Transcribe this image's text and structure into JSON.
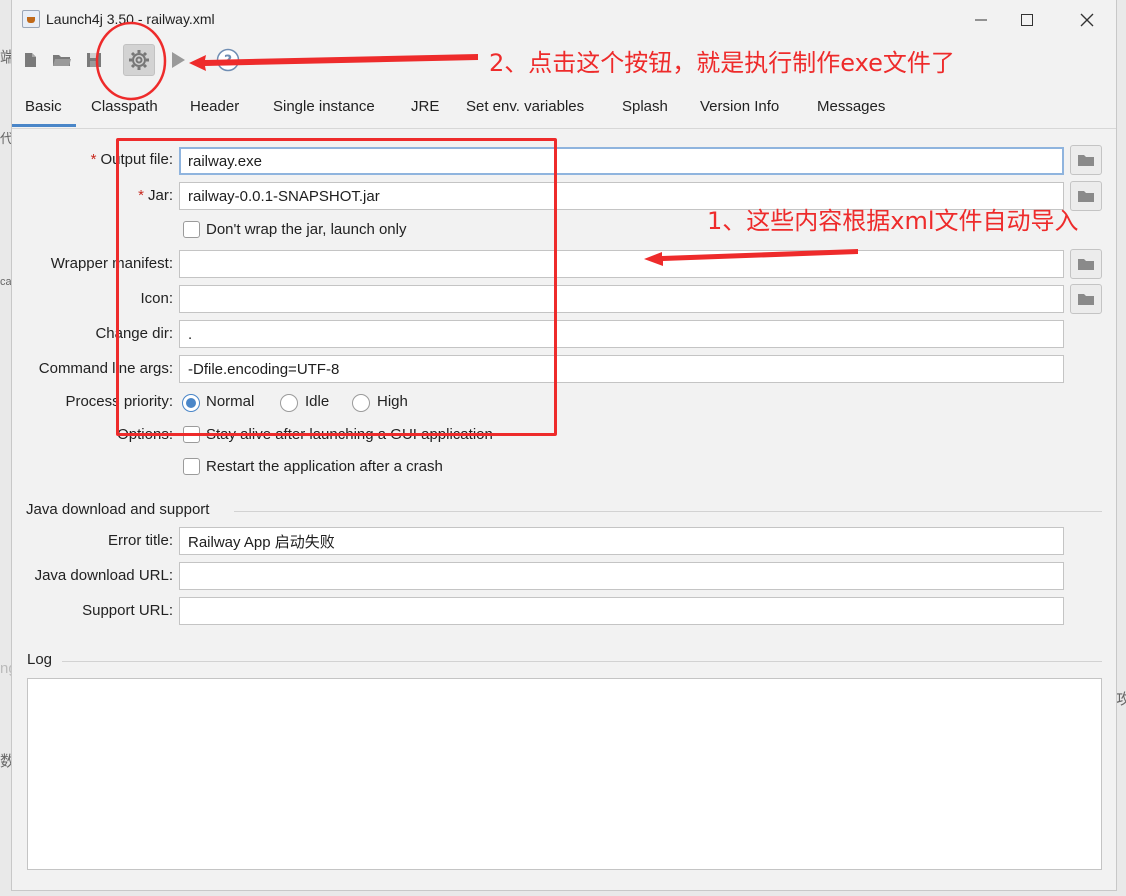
{
  "window": {
    "title": "Launch4j 3.50 - railway.xml"
  },
  "toolbar": {
    "buttons": [
      {
        "name": "new-config",
        "icon": "new-file-icon"
      },
      {
        "name": "open-config",
        "icon": "folder-open-icon"
      },
      {
        "name": "save-config",
        "icon": "save-icon"
      },
      {
        "name": "build-wrapper",
        "icon": "gear-icon",
        "active": true
      },
      {
        "name": "test-wrapper",
        "icon": "play-icon"
      },
      {
        "name": "about",
        "icon": "help-icon"
      }
    ]
  },
  "tabs": [
    "Basic",
    "Classpath",
    "Header",
    "Single instance",
    "JRE",
    "Set env. variables",
    "Splash",
    "Version Info",
    "Messages"
  ],
  "active_tab": "Basic",
  "basic": {
    "output_file": {
      "label": "Output file:",
      "value": "railway.exe",
      "required": true
    },
    "jar": {
      "label": "Jar:",
      "value": "railway-0.0.1-SNAPSHOT.jar",
      "required": true
    },
    "dont_wrap": {
      "label": "Don't wrap the jar, launch only",
      "checked": false
    },
    "wrapper_manifest": {
      "label": "Wrapper manifest:",
      "value": ""
    },
    "icon": {
      "label": "Icon:",
      "value": ""
    },
    "change_dir": {
      "label": "Change dir:",
      "value": "."
    },
    "cmd_args": {
      "label": "Command line args:",
      "value": "-Dfile.encoding=UTF-8"
    },
    "priority": {
      "label": "Process priority:",
      "options": [
        "Normal",
        "Idle",
        "High"
      ],
      "selected": "Normal"
    },
    "options": {
      "label": "Options:",
      "stay_alive": "Stay alive after launching a GUI application",
      "restart": "Restart the application after a crash"
    }
  },
  "java_support": {
    "section": "Java download and support",
    "error_title": {
      "label": "Error title:",
      "value": "Railway App 启动失败"
    },
    "download_url": {
      "label": "Java download URL:",
      "value": ""
    },
    "support_url": {
      "label": "Support URL:",
      "value": ""
    }
  },
  "log": {
    "section": "Log"
  },
  "annotations": {
    "step1": "1、这些内容根据xml文件自动导入",
    "step2": "2、点击这个按钮，就是执行制作exe文件了",
    "color": "#ee2b2b"
  },
  "background_fragments": [
    "端",
    "代",
    "ca",
    "ng",
    "数",
    "攻"
  ],
  "colors": {
    "accent": "#4a86c8",
    "required": "#c8281e"
  }
}
